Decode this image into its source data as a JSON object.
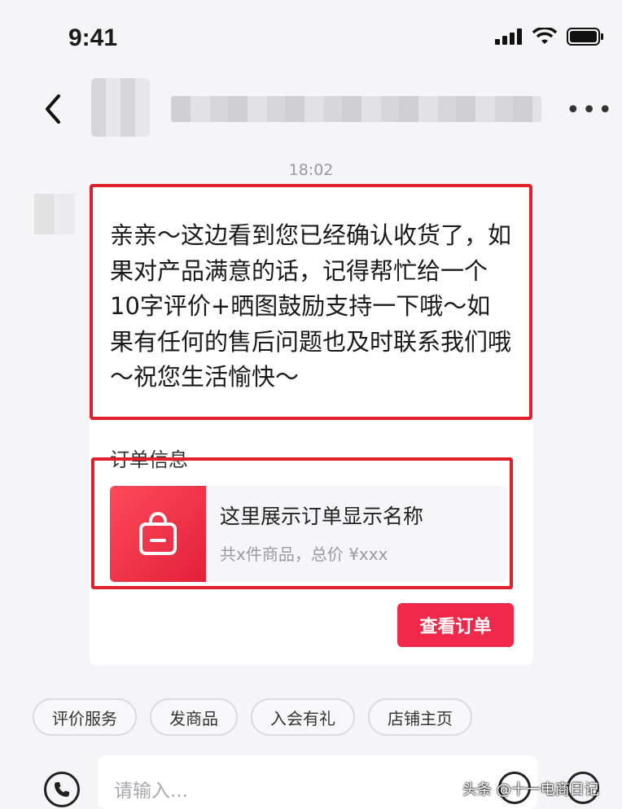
{
  "status_bar": {
    "time": "9:41"
  },
  "chat": {
    "timestamp": "18:02",
    "message": "亲亲～这边看到您已经确认收货了，如果对产品满意的话，记得帮忙给一个10字评价+晒图鼓励支持一下哦～如果有任何的售后问题也及时联系我们哦～祝您生活愉快～",
    "order_section_label": "订单信息",
    "order": {
      "name": "这里展示订单显示名称",
      "summary": "共x件商品，总价 ¥xxx",
      "thumbnail_icon": "shopping-bag-icon"
    },
    "view_order_label": "查看订单"
  },
  "quick_actions": [
    {
      "label": "评价服务"
    },
    {
      "label": "发商品"
    },
    {
      "label": "入会有礼"
    },
    {
      "label": "店铺主页"
    }
  ],
  "input": {
    "placeholder": "请输入..."
  },
  "watermark": "头条 @十一电商日记",
  "colors": {
    "accent": "#f0284a",
    "highlight_border": "#e0202a"
  }
}
